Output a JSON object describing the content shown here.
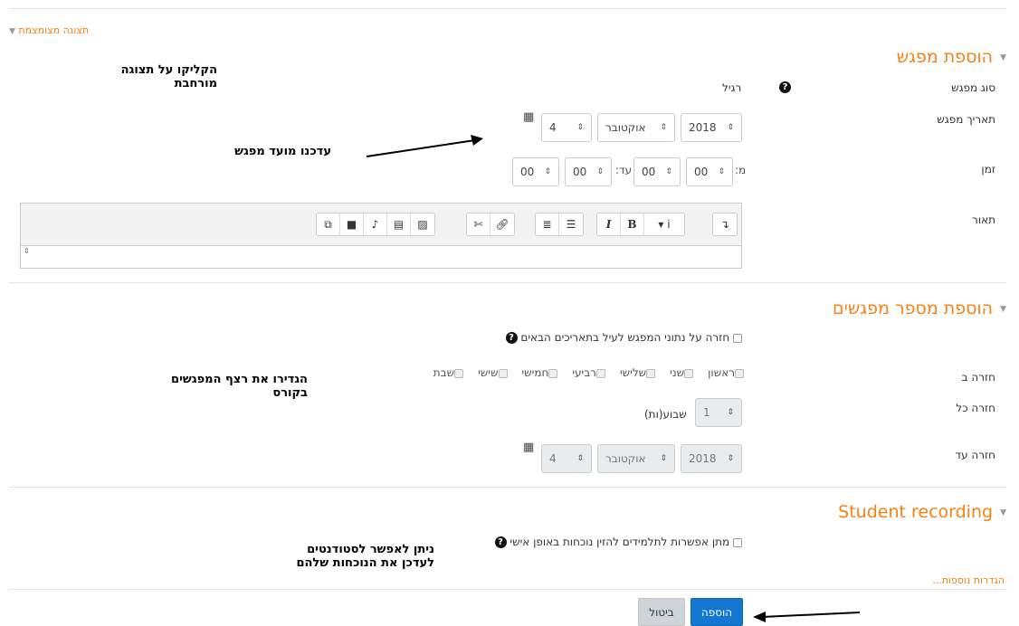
{
  "collapsed_view_link": "תצוגה מצומצמת",
  "section_add": {
    "title": "הוספת מפגש",
    "session_type_label": "סוג מפגש",
    "session_type_value": "רגיל",
    "date_label": "תאריך מפגש",
    "date": {
      "day": "4",
      "month": "אוקטובר",
      "year": "2018"
    },
    "time_label": "זמן",
    "time_from_label": "מ:",
    "time_to_label": "עד:",
    "time": {
      "from_hour": "00",
      "from_minute": "00",
      "to_hour": "00",
      "to_minute": "00"
    },
    "description_label": "תאור"
  },
  "section_multiple": {
    "title": "הוספת מספר מפגשים",
    "repeat_checkbox_label": "חזרה על נתוני המפגש לעיל בתאריכים הבאים",
    "repeat_on_label": "חזרה ב",
    "days": [
      "ראשון",
      "שני",
      "שלישי",
      "רביעי",
      "חמישי",
      "שישי",
      "שבת"
    ],
    "repeat_every_label": "חזרה כל",
    "repeat_every_value": "1",
    "repeat_every_unit": "שבוע(ות)",
    "repeat_until_label": "חזרה עד",
    "until": {
      "day": "4",
      "month": "אוקטובר",
      "year": "2018"
    }
  },
  "section_recording": {
    "title": "Student recording",
    "checkbox_label": "מתן אפשרות לתלמידים להזין נוכחות באופן אישי"
  },
  "more_settings_link": "הגדרות נוספות...",
  "buttons": {
    "add": "הוספה",
    "cancel": "ביטול"
  },
  "annotations": {
    "expand_view_line1": "הקליקו על תצוגה",
    "expand_view_line2": "מורחבת",
    "update_time": "עדכנו מועד מפגש",
    "sequence_line1": "הגדירו את רצף המפגשים",
    "sequence_line2": "בקורס",
    "students_line1": "ניתן לאפשר לסטודנטים",
    "students_line2": "לעדכן את הנוכחות שלהם"
  },
  "colors": {
    "accent": "#f98012",
    "primary_button": "#1177d1"
  },
  "icons": [
    "help-icon",
    "calendar-icon",
    "chevron-down-icon"
  ]
}
